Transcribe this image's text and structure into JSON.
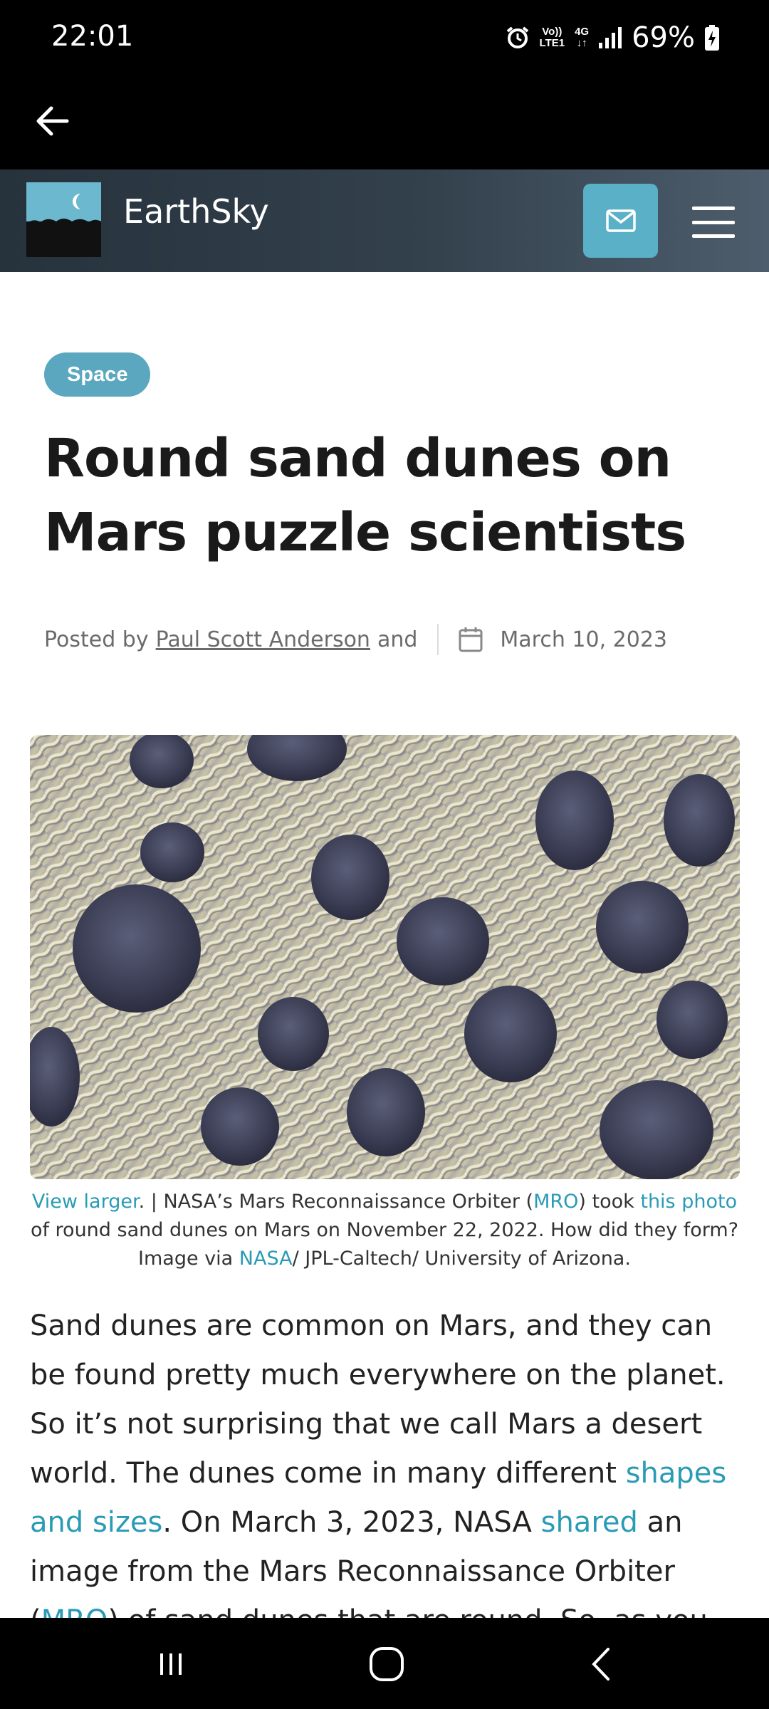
{
  "status_bar": {
    "time": "22:01",
    "network_top": "Vo))",
    "network_bottom": "LTE1",
    "network_type": "4G",
    "battery": "69%"
  },
  "app_bar": {
    "back_icon": "arrow-left-icon"
  },
  "header": {
    "site_name": "EarthSky",
    "mail_icon": "envelope-icon",
    "menu_icon": "hamburger-icon"
  },
  "article": {
    "category": "Space",
    "title": "Round sand dunes on Mars puzzle scientists",
    "posted_by": "Posted by",
    "author": "Paul Scott Anderson",
    "and": "and",
    "date": "March 10, 2023",
    "caption": {
      "view_larger": "View larger",
      "part1": ". | NASA’s Mars Reconnaissance Orbiter (",
      "mro": "MRO",
      "part2": ") took ",
      "this_photo": "this photo",
      "part3": " of round sand dunes on Mars on November 22, 2022. How did they form? Image via ",
      "nasa": "NASA",
      "part4": "/ JPL-Caltech/ University of Arizona."
    },
    "body": {
      "p1": "Sand dunes are common on Mars, and they can be found pretty much everywhere on the planet. So it’s not surprising that we call Mars a desert world. The dunes come in many different ",
      "link_shapes": "shapes and sizes",
      "p2": ". On March 3, 2023, NASA ",
      "link_shared": "shared",
      "p3": " an image from the Mars Reconnaissance Orbiter (",
      "link_mro": "MRO",
      "p4": ") of sand dunes that are round. So, as you can see, for the simple"
    }
  },
  "colors": {
    "accent": "#5aa7bf",
    "link": "#2a9bb5",
    "header_bg": "#33414d"
  }
}
